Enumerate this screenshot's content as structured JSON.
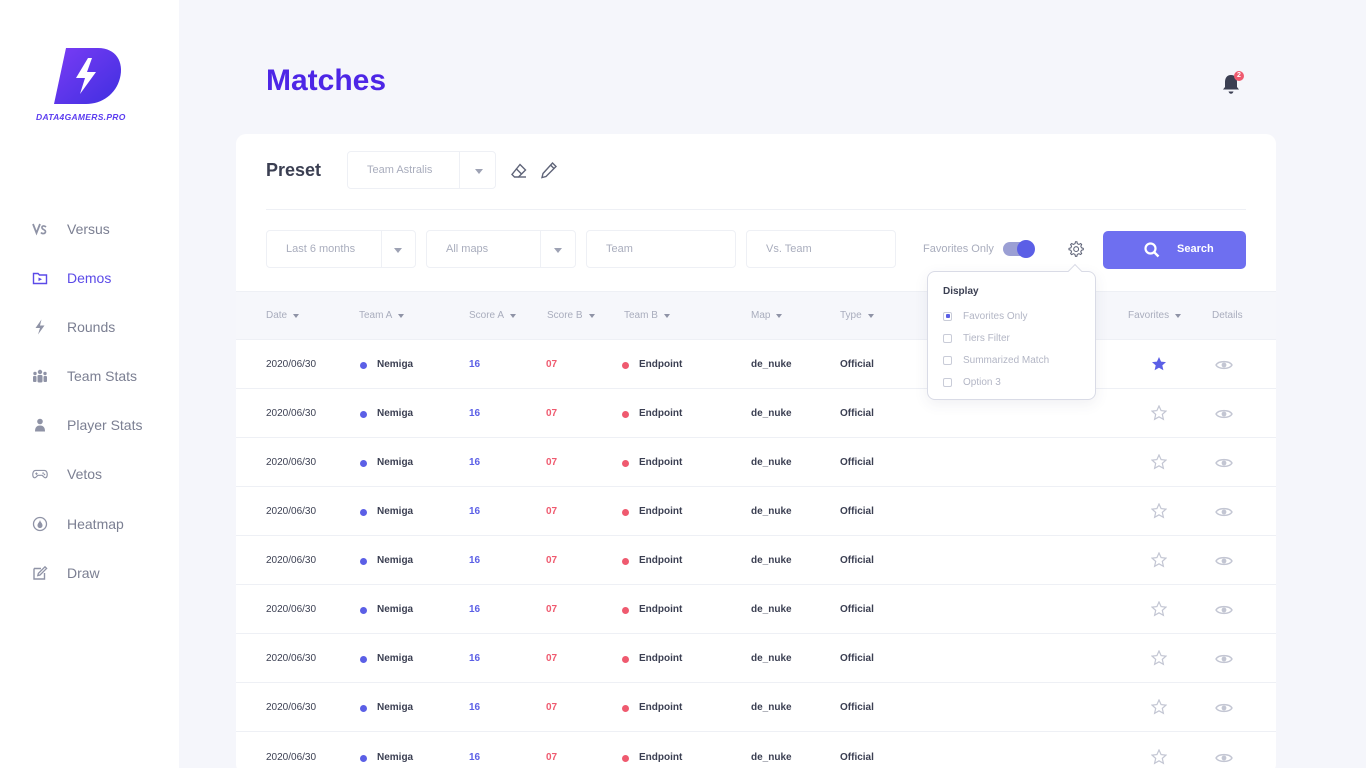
{
  "brand": {
    "name": "DATA4GAMERS.PRO",
    "color": "#5b3cf0"
  },
  "page": {
    "title": "Matches"
  },
  "notifications": {
    "count": "2"
  },
  "sidebar": {
    "items": [
      {
        "label": "Versus",
        "icon": "versus-icon",
        "active": false
      },
      {
        "label": "Demos",
        "icon": "folder-play-icon",
        "active": true
      },
      {
        "label": "Rounds",
        "icon": "lightning-icon",
        "active": false
      },
      {
        "label": "Team Stats",
        "icon": "team-icon",
        "active": false
      },
      {
        "label": "Player Stats",
        "icon": "user-icon",
        "active": false
      },
      {
        "label": "Vetos",
        "icon": "gamepad-icon",
        "active": false
      },
      {
        "label": "Heatmap",
        "icon": "heatmap-icon",
        "active": false
      },
      {
        "label": "Draw",
        "icon": "edit-icon",
        "active": false
      }
    ]
  },
  "preset": {
    "label": "Preset",
    "selected": "Team Astralis"
  },
  "filters": {
    "period": "Last 6 months",
    "maps": "All maps",
    "team_placeholder": "Team",
    "vs_team_placeholder": "Vs. Team",
    "favorites_label": "Favorites Only",
    "favorites_on": true,
    "search_label": "Search"
  },
  "display_menu": {
    "title": "Display",
    "options": [
      {
        "label": "Favorites Only",
        "checked": true
      },
      {
        "label": "Tiers Filter",
        "checked": false
      },
      {
        "label": "Summarized Match",
        "checked": false
      },
      {
        "label": "Option 3",
        "checked": false
      }
    ]
  },
  "table": {
    "columns": [
      "Date",
      "Team A",
      "Score A",
      "Score B",
      "Team B",
      "Map",
      "Type",
      "Favorites",
      "Details"
    ],
    "rows": [
      {
        "date": "2020/06/30",
        "team_a": "Nemiga",
        "score_a": "16",
        "score_b": "07",
        "team_b": "Endpoint",
        "map": "de_nuke",
        "type": "Official",
        "favorite": true
      },
      {
        "date": "2020/06/30",
        "team_a": "Nemiga",
        "score_a": "16",
        "score_b": "07",
        "team_b": "Endpoint",
        "map": "de_nuke",
        "type": "Official",
        "favorite": false
      },
      {
        "date": "2020/06/30",
        "team_a": "Nemiga",
        "score_a": "16",
        "score_b": "07",
        "team_b": "Endpoint",
        "map": "de_nuke",
        "type": "Official",
        "favorite": false
      },
      {
        "date": "2020/06/30",
        "team_a": "Nemiga",
        "score_a": "16",
        "score_b": "07",
        "team_b": "Endpoint",
        "map": "de_nuke",
        "type": "Official",
        "favorite": false
      },
      {
        "date": "2020/06/30",
        "team_a": "Nemiga",
        "score_a": "16",
        "score_b": "07",
        "team_b": "Endpoint",
        "map": "de_nuke",
        "type": "Official",
        "favorite": false
      },
      {
        "date": "2020/06/30",
        "team_a": "Nemiga",
        "score_a": "16",
        "score_b": "07",
        "team_b": "Endpoint",
        "map": "de_nuke",
        "type": "Official",
        "favorite": false
      },
      {
        "date": "2020/06/30",
        "team_a": "Nemiga",
        "score_a": "16",
        "score_b": "07",
        "team_b": "Endpoint",
        "map": "de_nuke",
        "type": "Official",
        "favorite": false
      },
      {
        "date": "2020/06/30",
        "team_a": "Nemiga",
        "score_a": "16",
        "score_b": "07",
        "team_b": "Endpoint",
        "map": "de_nuke",
        "type": "Official",
        "favorite": false
      },
      {
        "date": "2020/06/30",
        "team_a": "Nemiga",
        "score_a": "16",
        "score_b": "07",
        "team_b": "Endpoint",
        "map": "de_nuke",
        "type": "Official",
        "favorite": false
      }
    ]
  },
  "colors": {
    "accent": "#5b5fe6",
    "team_a_dot": "#5b5fe6",
    "team_b_dot": "#ef5a6f",
    "title": "#4d26e6"
  }
}
